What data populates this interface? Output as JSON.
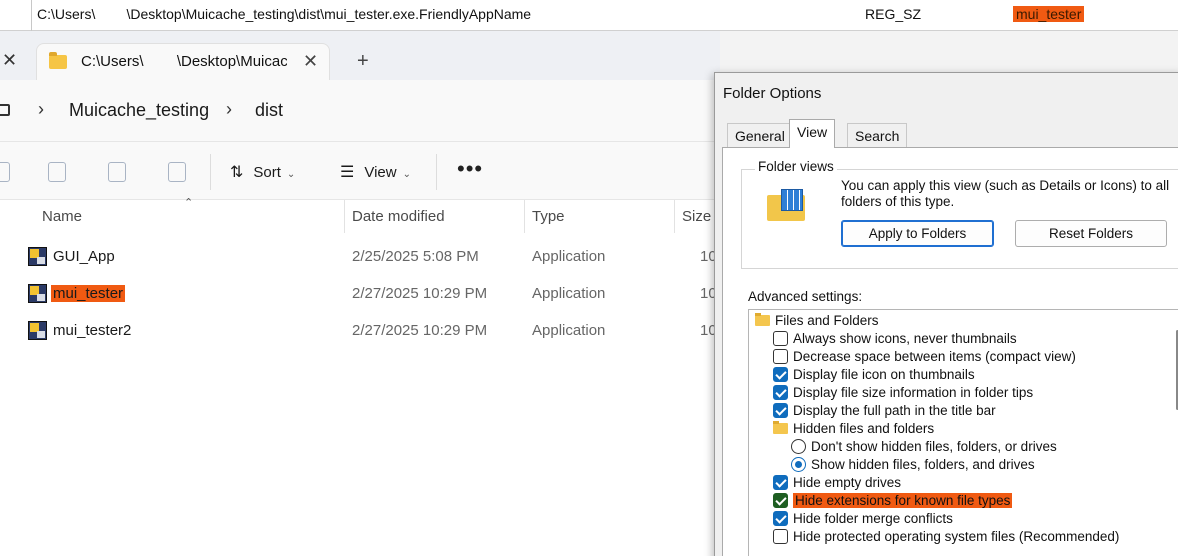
{
  "registry": {
    "path": "C:\\Users\\        \\Desktop\\Muicache_testing\\dist\\mui_tester.exe.FriendlyAppName",
    "type": "REG_SZ",
    "data": "mui_tester",
    "highlight_color": "#f05a12"
  },
  "explorer": {
    "tab_title": "C:\\Users\\        \\Desktop\\Muicac",
    "breadcrumb": [
      "Muicache_testing",
      "dist"
    ],
    "toolbar": {
      "sort_label": "Sort",
      "view_label": "View",
      "more_label": "•••"
    },
    "columns": [
      "Name",
      "Date modified",
      "Type",
      "Size"
    ],
    "files": [
      {
        "name": "GUI_App",
        "date": "2/25/2025 5:08 PM",
        "type": "Application",
        "size": "10",
        "highlighted": false
      },
      {
        "name": "mui_tester",
        "date": "2/27/2025 10:29 PM",
        "type": "Application",
        "size": "10",
        "highlighted": true
      },
      {
        "name": "mui_tester2",
        "date": "2/27/2025 10:29 PM",
        "type": "Application",
        "size": "10",
        "highlighted": false
      }
    ]
  },
  "dialog": {
    "title": "Folder Options",
    "tabs": [
      "General",
      "View",
      "Search"
    ],
    "active_tab": "View",
    "folder_views": {
      "legend": "Folder views",
      "description": "You can apply this view (such as Details or Icons) to all folders of this type.",
      "apply_button": "Apply to Folders",
      "reset_button": "Reset Folders"
    },
    "advanced_label": "Advanced settings:",
    "settings": [
      {
        "kind": "folder",
        "label": "Files and Folders",
        "indent": 0
      },
      {
        "kind": "checkbox",
        "label": "Always show icons, never thumbnails",
        "checked": false,
        "indent": 1
      },
      {
        "kind": "checkbox",
        "label": "Decrease space between items (compact view)",
        "checked": false,
        "indent": 1
      },
      {
        "kind": "checkbox",
        "label": "Display file icon on thumbnails",
        "checked": true,
        "indent": 1
      },
      {
        "kind": "checkbox",
        "label": "Display file size information in folder tips",
        "checked": true,
        "indent": 1
      },
      {
        "kind": "checkbox",
        "label": "Display the full path in the title bar",
        "checked": true,
        "indent": 1
      },
      {
        "kind": "folder",
        "label": "Hidden files and folders",
        "indent": 1
      },
      {
        "kind": "radio",
        "label": "Don't show hidden files, folders, or drives",
        "checked": false,
        "indent": 2
      },
      {
        "kind": "radio",
        "label": "Show hidden files, folders, and drives",
        "checked": true,
        "indent": 2
      },
      {
        "kind": "checkbox",
        "label": "Hide empty drives",
        "checked": true,
        "indent": 1
      },
      {
        "kind": "checkbox",
        "label": "Hide extensions for known file types",
        "checked": true,
        "indent": 1,
        "highlighted": true
      },
      {
        "kind": "checkbox",
        "label": "Hide folder merge conflicts",
        "checked": true,
        "indent": 1
      },
      {
        "kind": "checkbox",
        "label": "Hide protected operating system files (Recommended)",
        "checked": false,
        "indent": 1
      }
    ]
  }
}
